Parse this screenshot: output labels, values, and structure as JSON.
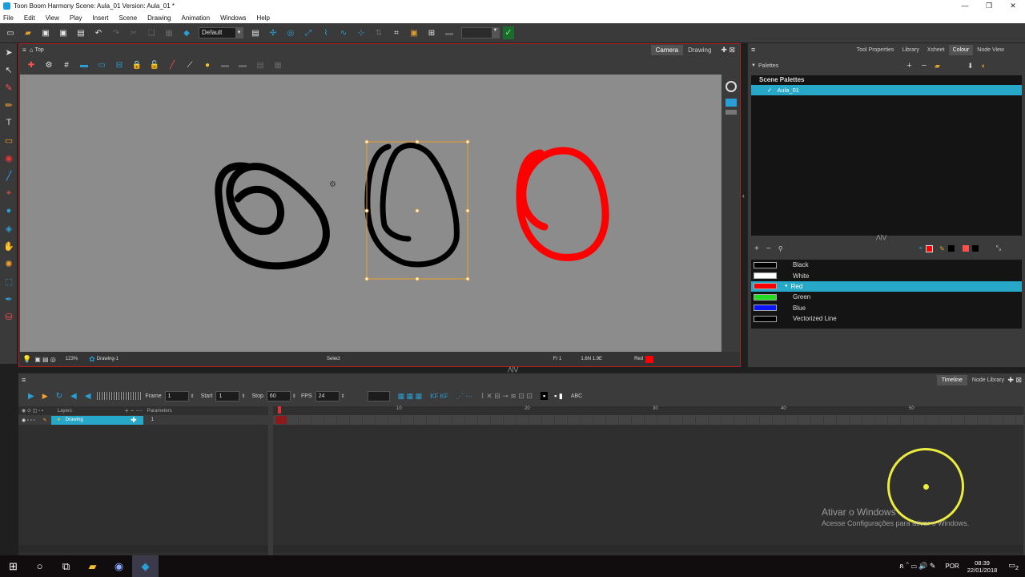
{
  "window": {
    "title": "Toon Boom Harmony Scene: Aula_01 Version: Aula_01 *"
  },
  "menu": [
    "File",
    "Edit",
    "View",
    "Play",
    "Insert",
    "Scene",
    "Drawing",
    "Animation",
    "Windows",
    "Help"
  ],
  "toolbar": {
    "workspace": "Default"
  },
  "view": {
    "breadcrumb": "Top",
    "tabs": [
      "Camera",
      "Drawing"
    ],
    "active_tab": "Camera",
    "status": {
      "zoom": "123%",
      "drawing": "Drawing-1",
      "tool": "Select",
      "frame": "Fr 1",
      "coords": "1.6N 1.9E",
      "colour": "Red"
    }
  },
  "palette_panel": {
    "tabs": [
      "Tool Properties",
      "Library",
      "Xsheet",
      "Colour",
      "Node View"
    ],
    "active_tab": "Colour",
    "palettes_label": "Palettes",
    "scene_palettes_label": "Scene Palettes",
    "palette_item": "Aula_01",
    "colours": [
      {
        "name": "Black",
        "hex": "#000000"
      },
      {
        "name": "White",
        "hex": "#ffffff"
      },
      {
        "name": "Red",
        "hex": "#ff0000",
        "selected": true
      },
      {
        "name": "Green",
        "hex": "#22dd22"
      },
      {
        "name": "Blue",
        "hex": "#0a14ff"
      },
      {
        "name": "Vectorized Line",
        "hex": "#000000"
      }
    ]
  },
  "timeline": {
    "tabs": [
      "Timeline",
      "Node Library"
    ],
    "active_tab": "Timeline",
    "frame_label": "Frame",
    "frame": "1",
    "start_label": "Start",
    "start": "1",
    "stop_label": "Stop",
    "stop": "60",
    "fps_label": "FPS",
    "fps": "24",
    "layers_header": "Layers",
    "params_header": "Parameters",
    "layer_name": "Drawing",
    "layer_frame": "1",
    "ruler": [
      "10",
      "20",
      "30",
      "40",
      "50"
    ]
  },
  "watermark": {
    "line1": "Ativar o Windows",
    "line2": "Acesse Configurações para ativar o Windows."
  },
  "taskbar": {
    "lang": "POR",
    "time": "08:39",
    "date": "22/01/2018",
    "notif": "2"
  },
  "colors": {
    "accent": "#28a8c8",
    "red_stroke": "#ff0000",
    "panel_border": "#b32020",
    "canvas": "#8c8c8c"
  }
}
